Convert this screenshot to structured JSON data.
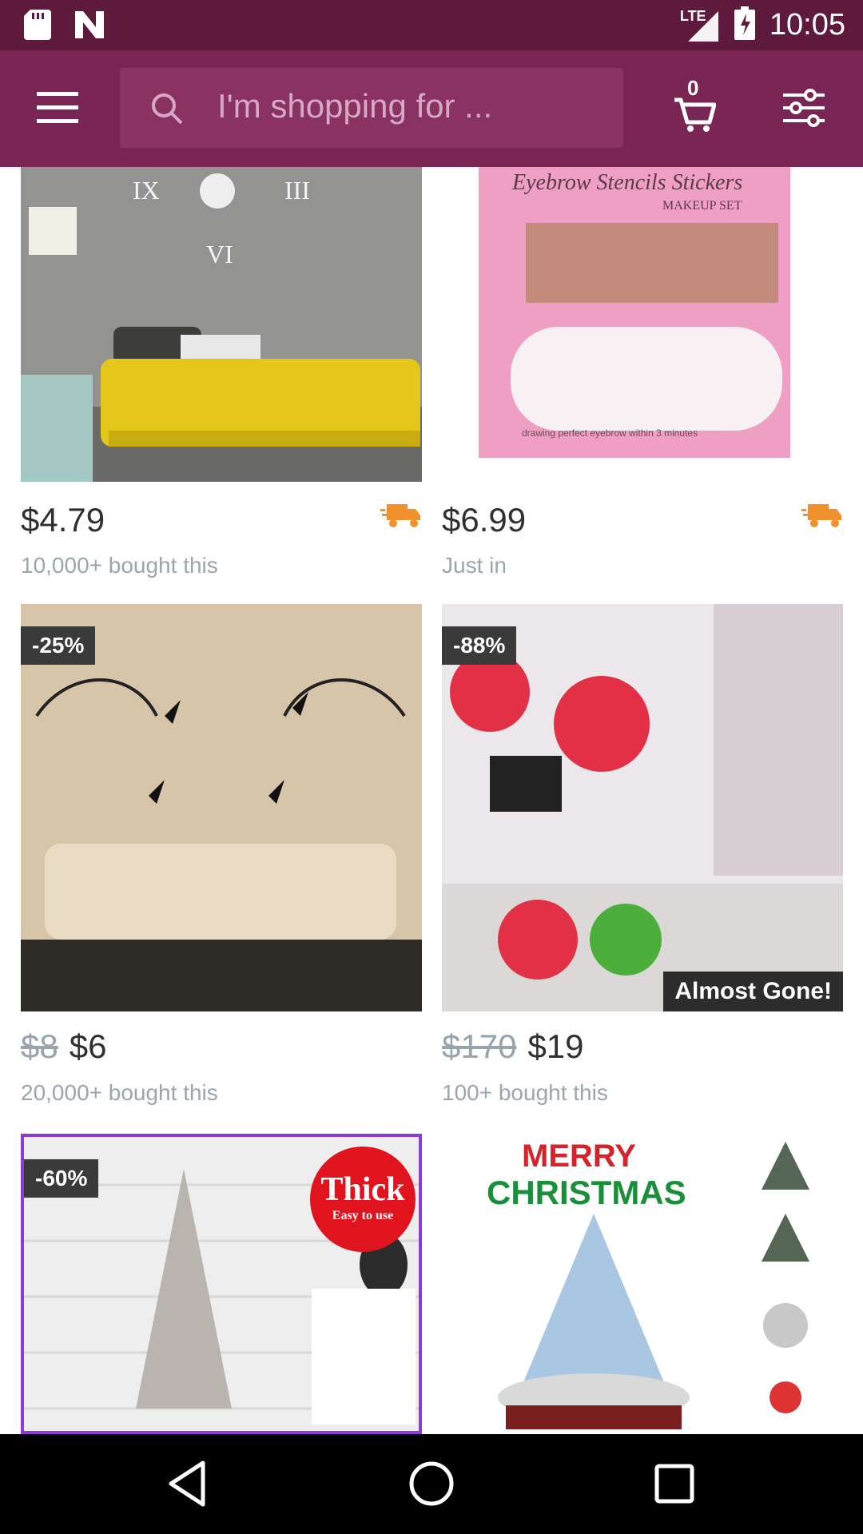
{
  "status_bar": {
    "network": "LTE",
    "time": "10:05"
  },
  "app_bar": {
    "search_placeholder": "I'm shopping for ...",
    "cart_count": "0"
  },
  "products": [
    {
      "image": "wall clock living room",
      "price": "$4.79",
      "meta": "10,000+ bought this",
      "badge": "",
      "fast_shipping": true
    },
    {
      "image": "eyebrow stencil kit",
      "image_text": {
        "title": "Eyebrow Stencils Stickers",
        "subtitle": "MAKEUP SET",
        "caption": "drawing perfect eyebrow within 3 minutes"
      },
      "price": "$6.99",
      "meta": "Just in",
      "badge": "",
      "fast_shipping": true
    },
    {
      "image": "butterfly wall decal",
      "original_price": "$8",
      "price": "$6",
      "meta": "20,000+ bought this",
      "badge": "-25%"
    },
    {
      "image": "red tree wall decal",
      "original_price": "$170",
      "price": "$19",
      "meta": "100+ bought this",
      "badge": "-88%",
      "ribbon": "Almost Gone!"
    },
    {
      "image": "3D wall panel",
      "image_text": {
        "sticker_title": "Thick",
        "sticker_sub": "Easy to use"
      },
      "badge": "-60%"
    },
    {
      "image": "christmas tree",
      "image_text": {
        "line1": "MERRY",
        "line2": "CHRISTMAS"
      }
    }
  ],
  "colors": {
    "status_bar": "#5e1a3c",
    "app_bar": "#7a2654",
    "shipping_icon": "#f0912e"
  },
  "icons": [
    "sd-card-icon",
    "n-icon",
    "lte-signal-icon",
    "battery-icon",
    "menu-icon",
    "search-icon",
    "cart-icon",
    "filter-icon",
    "truck-icon",
    "back-icon",
    "home-icon",
    "recents-icon"
  ]
}
